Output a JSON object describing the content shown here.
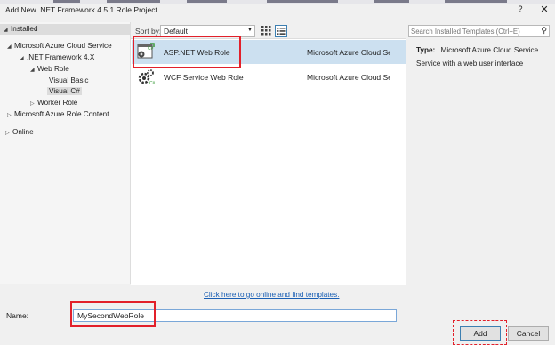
{
  "window": {
    "title": "Add New .NET Framework 4.5.1 Role Project",
    "help": "?",
    "close": "✕"
  },
  "tree": {
    "header": "Installed",
    "items": [
      {
        "label": "Microsoft Azure Cloud Service",
        "expanded": true
      },
      {
        "label": ".NET Framework 4.X",
        "expanded": true
      },
      {
        "label": "Web Role",
        "expanded": true
      },
      {
        "label": "Visual Basic"
      },
      {
        "label": "Visual C#",
        "selected": true
      },
      {
        "label": "Worker Role",
        "expanded": false
      },
      {
        "label": "Microsoft Azure Role Content",
        "expanded": false
      }
    ],
    "online": "Online"
  },
  "sort": {
    "label": "Sort by:",
    "value": "Default"
  },
  "templates": [
    {
      "name": "ASP.NET Web Role",
      "type": "Microsoft Azure Cloud Ser",
      "icon": "aspnet-web-role-icon",
      "selected": true
    },
    {
      "name": "WCF Service Web Role",
      "type": "Microsoft Azure Cloud Ser",
      "icon": "wcf-gear-icon"
    }
  ],
  "search": {
    "placeholder": "Search Installed Templates (Ctrl+E)"
  },
  "description": {
    "type_label": "Type:",
    "type_value": "Microsoft Azure Cloud Service",
    "text": "Service with a web user interface"
  },
  "online_link": "Click here to go online and find templates.",
  "name_field": {
    "label": "Name:",
    "value": "MySecondWebRole"
  },
  "buttons": {
    "add": "Add",
    "cancel": "Cancel"
  },
  "colors": {
    "highlight_red": "#e2202a",
    "selection_blue": "#cce0f0",
    "link_blue": "#1a5fb4"
  }
}
